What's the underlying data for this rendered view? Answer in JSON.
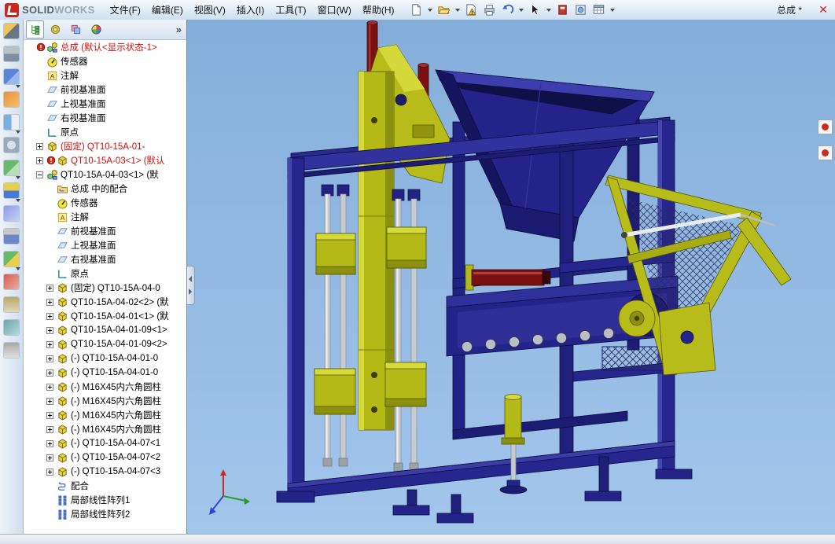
{
  "window": {
    "brand_bold": "SOLID",
    "brand_light": "WORKS",
    "doc_title": "总成 *"
  },
  "glyphs": {
    "annotation_a": "A",
    "overflow": "»",
    "close": "✕"
  },
  "menu": {
    "items": [
      "文件(F)",
      "编辑(E)",
      "视图(V)",
      "插入(I)",
      "工具(T)",
      "窗口(W)",
      "帮助(H)"
    ]
  },
  "top_toolbar": {
    "icons": [
      "new-document",
      "open-folder",
      "document-warning",
      "print",
      "undo",
      "select-arrow",
      "toolbox",
      "view-settings",
      "design-table"
    ]
  },
  "left_toolbar": {
    "icons": [
      "sketch",
      "dimension",
      "pattern",
      "appearance",
      "section-view",
      "rotate-view",
      "insert-component",
      "mate",
      "move-component",
      "smart-fastener",
      "exploded-view",
      "interference-detection",
      "measure",
      "mass-properties",
      "equations"
    ]
  },
  "tree_panel": {
    "header_tabs": [
      "feature-manager",
      "property-manager",
      "configuration-manager",
      "display-manager"
    ],
    "items": [
      {
        "label": "总成 (默认<显示状态-1>"
      },
      {
        "label": "传感器"
      },
      {
        "label": "注解"
      },
      {
        "label": "前视基准面"
      },
      {
        "label": "上视基准面"
      },
      {
        "label": "右视基准面"
      },
      {
        "label": "原点"
      },
      {
        "label": "(固定) QT10-15A-01-"
      },
      {
        "label": "QT10-15A-03<1> (默认"
      },
      {
        "label": "QT10-15A-04-03<1> (默"
      },
      {
        "label": "总成 中的配合"
      },
      {
        "label": "传感器"
      },
      {
        "label": "注解"
      },
      {
        "label": "前视基准面"
      },
      {
        "label": "上视基准面"
      },
      {
        "label": "右视基准面"
      },
      {
        "label": "原点"
      },
      {
        "label": "(固定) QT10-15A-04-0"
      },
      {
        "label": "QT10-15A-04-02<2> (默"
      },
      {
        "label": "QT10-15A-04-01<1> (默"
      },
      {
        "label": "QT10-15A-04-01-09<1>"
      },
      {
        "label": "QT10-15A-04-01-09<2>"
      },
      {
        "label": "(-) QT10-15A-04-01-0"
      },
      {
        "label": "(-) QT10-15A-04-01-0"
      },
      {
        "label": "(-) M16X45内六角圆柱"
      },
      {
        "label": "(-) M16X45内六角圆柱"
      },
      {
        "label": "(-) M16X45内六角圆柱"
      },
      {
        "label": "(-) M16X45内六角圆柱"
      },
      {
        "label": "(-) QT10-15A-04-07<1"
      },
      {
        "label": "(-) QT10-15A-04-07<2"
      },
      {
        "label": "(-) QT10-15A-04-07<3"
      },
      {
        "label": "配合"
      },
      {
        "label": "局部线性阵列1"
      },
      {
        "label": "局部线性阵列2"
      }
    ]
  },
  "colors": {
    "sky": "#8cb3df",
    "machine_navy": "#23238a",
    "machine_yellow": "#b5b917",
    "machine_red": "#7c1010",
    "error_red_text": "#cc1111",
    "titlebar": "#dce6f2"
  }
}
